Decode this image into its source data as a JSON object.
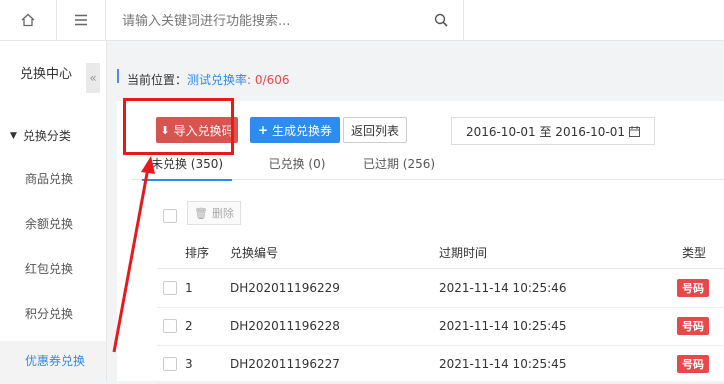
{
  "topbar": {
    "search_placeholder": "请输入关键词进行功能搜索..."
  },
  "sidebar": {
    "title": "兑换中心",
    "group_label": "兑换分类",
    "items": [
      {
        "label": "商品兑换"
      },
      {
        "label": "余额兑换"
      },
      {
        "label": "红包兑换"
      },
      {
        "label": "积分兑换"
      },
      {
        "label": "优惠券兑换"
      }
    ]
  },
  "breadcrumb": {
    "prefix": "当前位置：",
    "link": "测试兑换率",
    "count": ": 0/606"
  },
  "toolbar": {
    "import_label": "导入兑换码",
    "generate_label": "生成兑换券",
    "back_label": "返回列表",
    "date_range": "2016-10-01 至 2016-10-01"
  },
  "tabs": [
    {
      "label": "未兑换 (350)"
    },
    {
      "label": "已兑换 (0)"
    },
    {
      "label": "已过期 (256)"
    }
  ],
  "delete_label": "删除",
  "table": {
    "headers": {
      "index": "排序",
      "code": "兑换编号",
      "expire": "过期时间",
      "type": "类型"
    },
    "rows": [
      {
        "index": "1",
        "code": "DH202011196229",
        "expire": "2021-11-14 10:25:46",
        "type": "号码"
      },
      {
        "index": "2",
        "code": "DH202011196228",
        "expire": "2021-11-14 10:25:45",
        "type": "号码"
      },
      {
        "index": "3",
        "code": "DH202011196227",
        "expire": "2021-11-14 10:25:45",
        "type": "号码"
      }
    ]
  },
  "colors": {
    "accent": "#2d8cf0",
    "danger": "#d9534f",
    "annotation": "#e8191c"
  }
}
